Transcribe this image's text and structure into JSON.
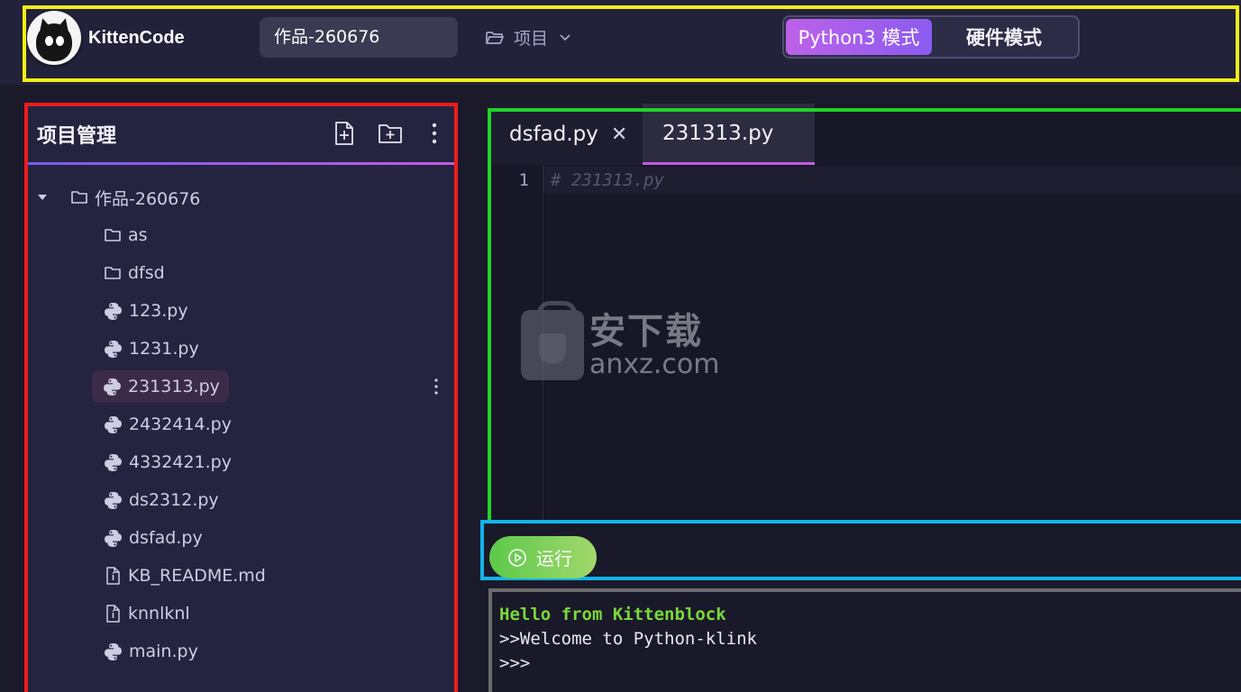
{
  "header": {
    "brand": "KittenCode",
    "project_name": "作品-260676",
    "project_menu_label": "项目",
    "modes": [
      {
        "label": "Python3 模式",
        "active": true
      },
      {
        "label": "硬件模式",
        "active": false
      }
    ]
  },
  "sidebar": {
    "title": "项目管理",
    "root_folder": "作品-260676",
    "items": [
      {
        "name": "as",
        "type": "folder"
      },
      {
        "name": "dfsd",
        "type": "folder"
      },
      {
        "name": "123.py",
        "type": "python"
      },
      {
        "name": "1231.py",
        "type": "python"
      },
      {
        "name": "231313.py",
        "type": "python",
        "selected": true
      },
      {
        "name": "2432414.py",
        "type": "python"
      },
      {
        "name": "4332421.py",
        "type": "python"
      },
      {
        "name": "ds2312.py",
        "type": "python"
      },
      {
        "name": "dsfad.py",
        "type": "python"
      },
      {
        "name": "KB_README.md",
        "type": "file"
      },
      {
        "name": "knnlknl",
        "type": "file"
      },
      {
        "name": "main.py",
        "type": "python"
      }
    ]
  },
  "editor": {
    "tabs": [
      {
        "label": "dsfad.py",
        "closable": true,
        "active": false
      },
      {
        "label": "231313.py",
        "closable": false,
        "active": true
      }
    ],
    "lines": [
      {
        "no": "1",
        "text": "# 231313.py"
      }
    ]
  },
  "watermark": {
    "cn": "安下载",
    "en": "anxz.com"
  },
  "run": {
    "label": "运行"
  },
  "console": {
    "lines": [
      "Hello from Kittenblock",
      ">>Welcome to Python-klink",
      ">>>"
    ]
  },
  "colors": {
    "accent_purple": "#bd61e8",
    "run_green": "#5cc94a",
    "highlight_yellow": "#f2ee16",
    "highlight_red": "#ee1c1c",
    "highlight_green": "#22d22a",
    "highlight_blue": "#14b4ea"
  }
}
